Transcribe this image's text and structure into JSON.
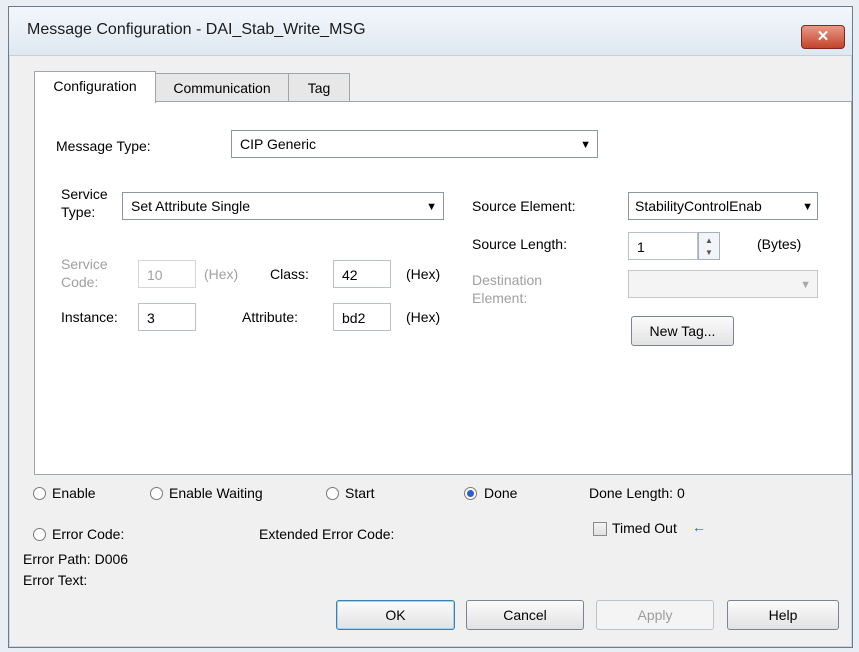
{
  "window": {
    "title": "Message Configuration - DAI_Stab_Write_MSG",
    "close_label": "✕"
  },
  "tabs": [
    {
      "label": "Configuration"
    },
    {
      "label": "Communication"
    },
    {
      "label": "Tag"
    }
  ],
  "config": {
    "message_type_label": "Message Type:",
    "message_type_value": "CIP Generic",
    "service_type_label_1": "Service",
    "service_type_label_2": "Type:",
    "service_type_value": "Set Attribute Single",
    "service_code_label_1": "Service",
    "service_code_label_2": "Code:",
    "service_code_value": "10",
    "hex_unit": "(Hex)",
    "class_label": "Class:",
    "class_value": "42",
    "instance_label": "Instance:",
    "instance_value": "3",
    "attribute_label": "Attribute:",
    "attribute_value": "bd2",
    "source_element_label": "Source Element:",
    "source_element_value": "StabilityControlEnab",
    "source_length_label": "Source Length:",
    "source_length_value": "1",
    "bytes_unit": "(Bytes)",
    "destination_label_1": "Destination",
    "destination_label_2": "Element:",
    "destination_value": "",
    "new_tag_label": "New Tag..."
  },
  "status": {
    "enable": "Enable",
    "enable_waiting": "Enable Waiting",
    "start": "Start",
    "done": "Done",
    "done_length": "Done Length: 0",
    "error_code": "Error Code:",
    "extended_error_code": "Extended Error Code:",
    "timed_out": "Timed Out",
    "timed_out_arrow": "←",
    "error_path": "Error Path: D006",
    "error_text": "Error Text:"
  },
  "buttons": {
    "ok": "OK",
    "cancel": "Cancel",
    "apply": "Apply",
    "help": "Help"
  },
  "colors": {
    "close_button": "#c4432c",
    "radio_selected": "#2b5fd0",
    "arrow": "#2b5fd0"
  }
}
